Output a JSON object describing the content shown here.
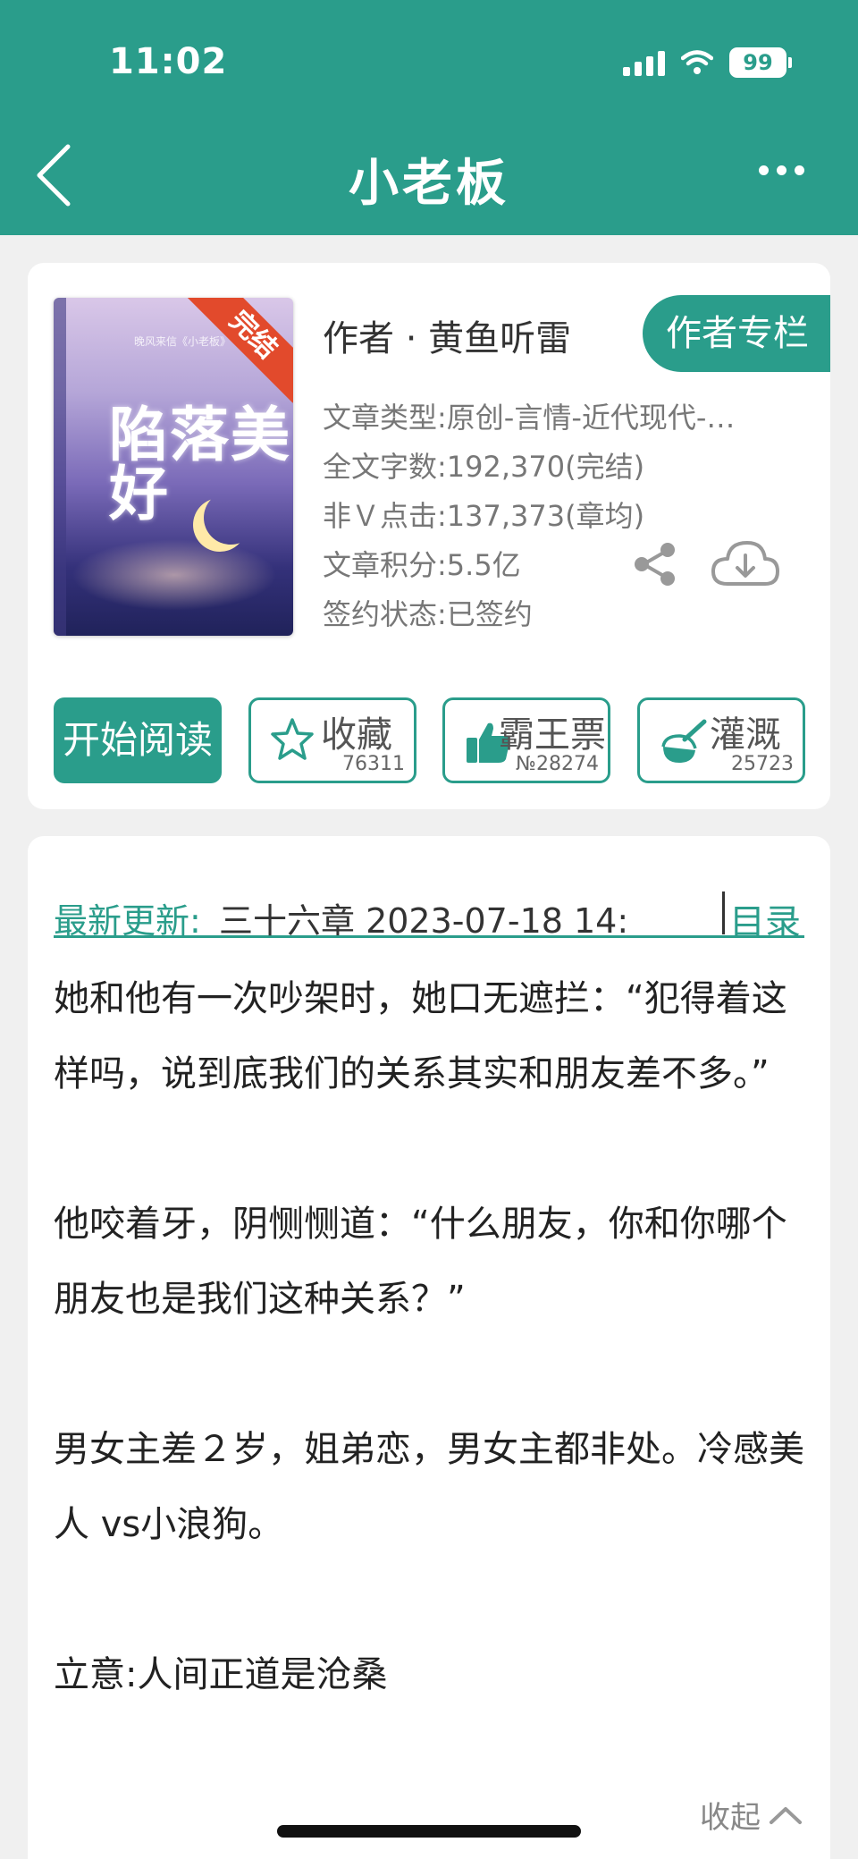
{
  "status_bar": {
    "time": "11:02",
    "battery": "99"
  },
  "header": {
    "title": "小老板"
  },
  "book": {
    "cover_title": "陷落美好",
    "cover_small": "晚风来信《小老板》",
    "ribbon": "完结",
    "author": "作者 · 黄鱼听雷",
    "author_column_label": "作者专栏",
    "meta": [
      "文章类型:原创-言情-近代现代-…",
      "全文字数:192,370(完结)",
      "非Ｖ点击:137,373(章均)",
      "文章积分:5.5亿",
      "签约状态:已签约"
    ]
  },
  "actions": {
    "read_label": "开始阅读",
    "collect": {
      "label": "收藏",
      "count": "76311"
    },
    "vote": {
      "label": "霸王票",
      "count": "№28274"
    },
    "nutrient": {
      "label": "灌溉",
      "count": "25723"
    }
  },
  "latest": {
    "label": "最新更新:",
    "value": "三十六章 2023-07-18 14:",
    "toc_label": "目录"
  },
  "synopsis": [
    "她和他有一次吵架时，她口无遮拦：“犯得着这样吗，说到底我们的关系其实和朋友差不多。”",
    "",
    "他咬着牙，阴恻恻道：“什么朋友，你和你哪个朋友也是我们这种关系？”",
    "",
    "男女主差２岁，姐弟恋，男女主都非处。冷感美人 vs小浪狗。",
    "",
    "立意:人间正道是沧桑"
  ],
  "collapse_label": "收起",
  "colors": {
    "brand": "#2a9d8b",
    "ribbon": "#e24a2c"
  }
}
